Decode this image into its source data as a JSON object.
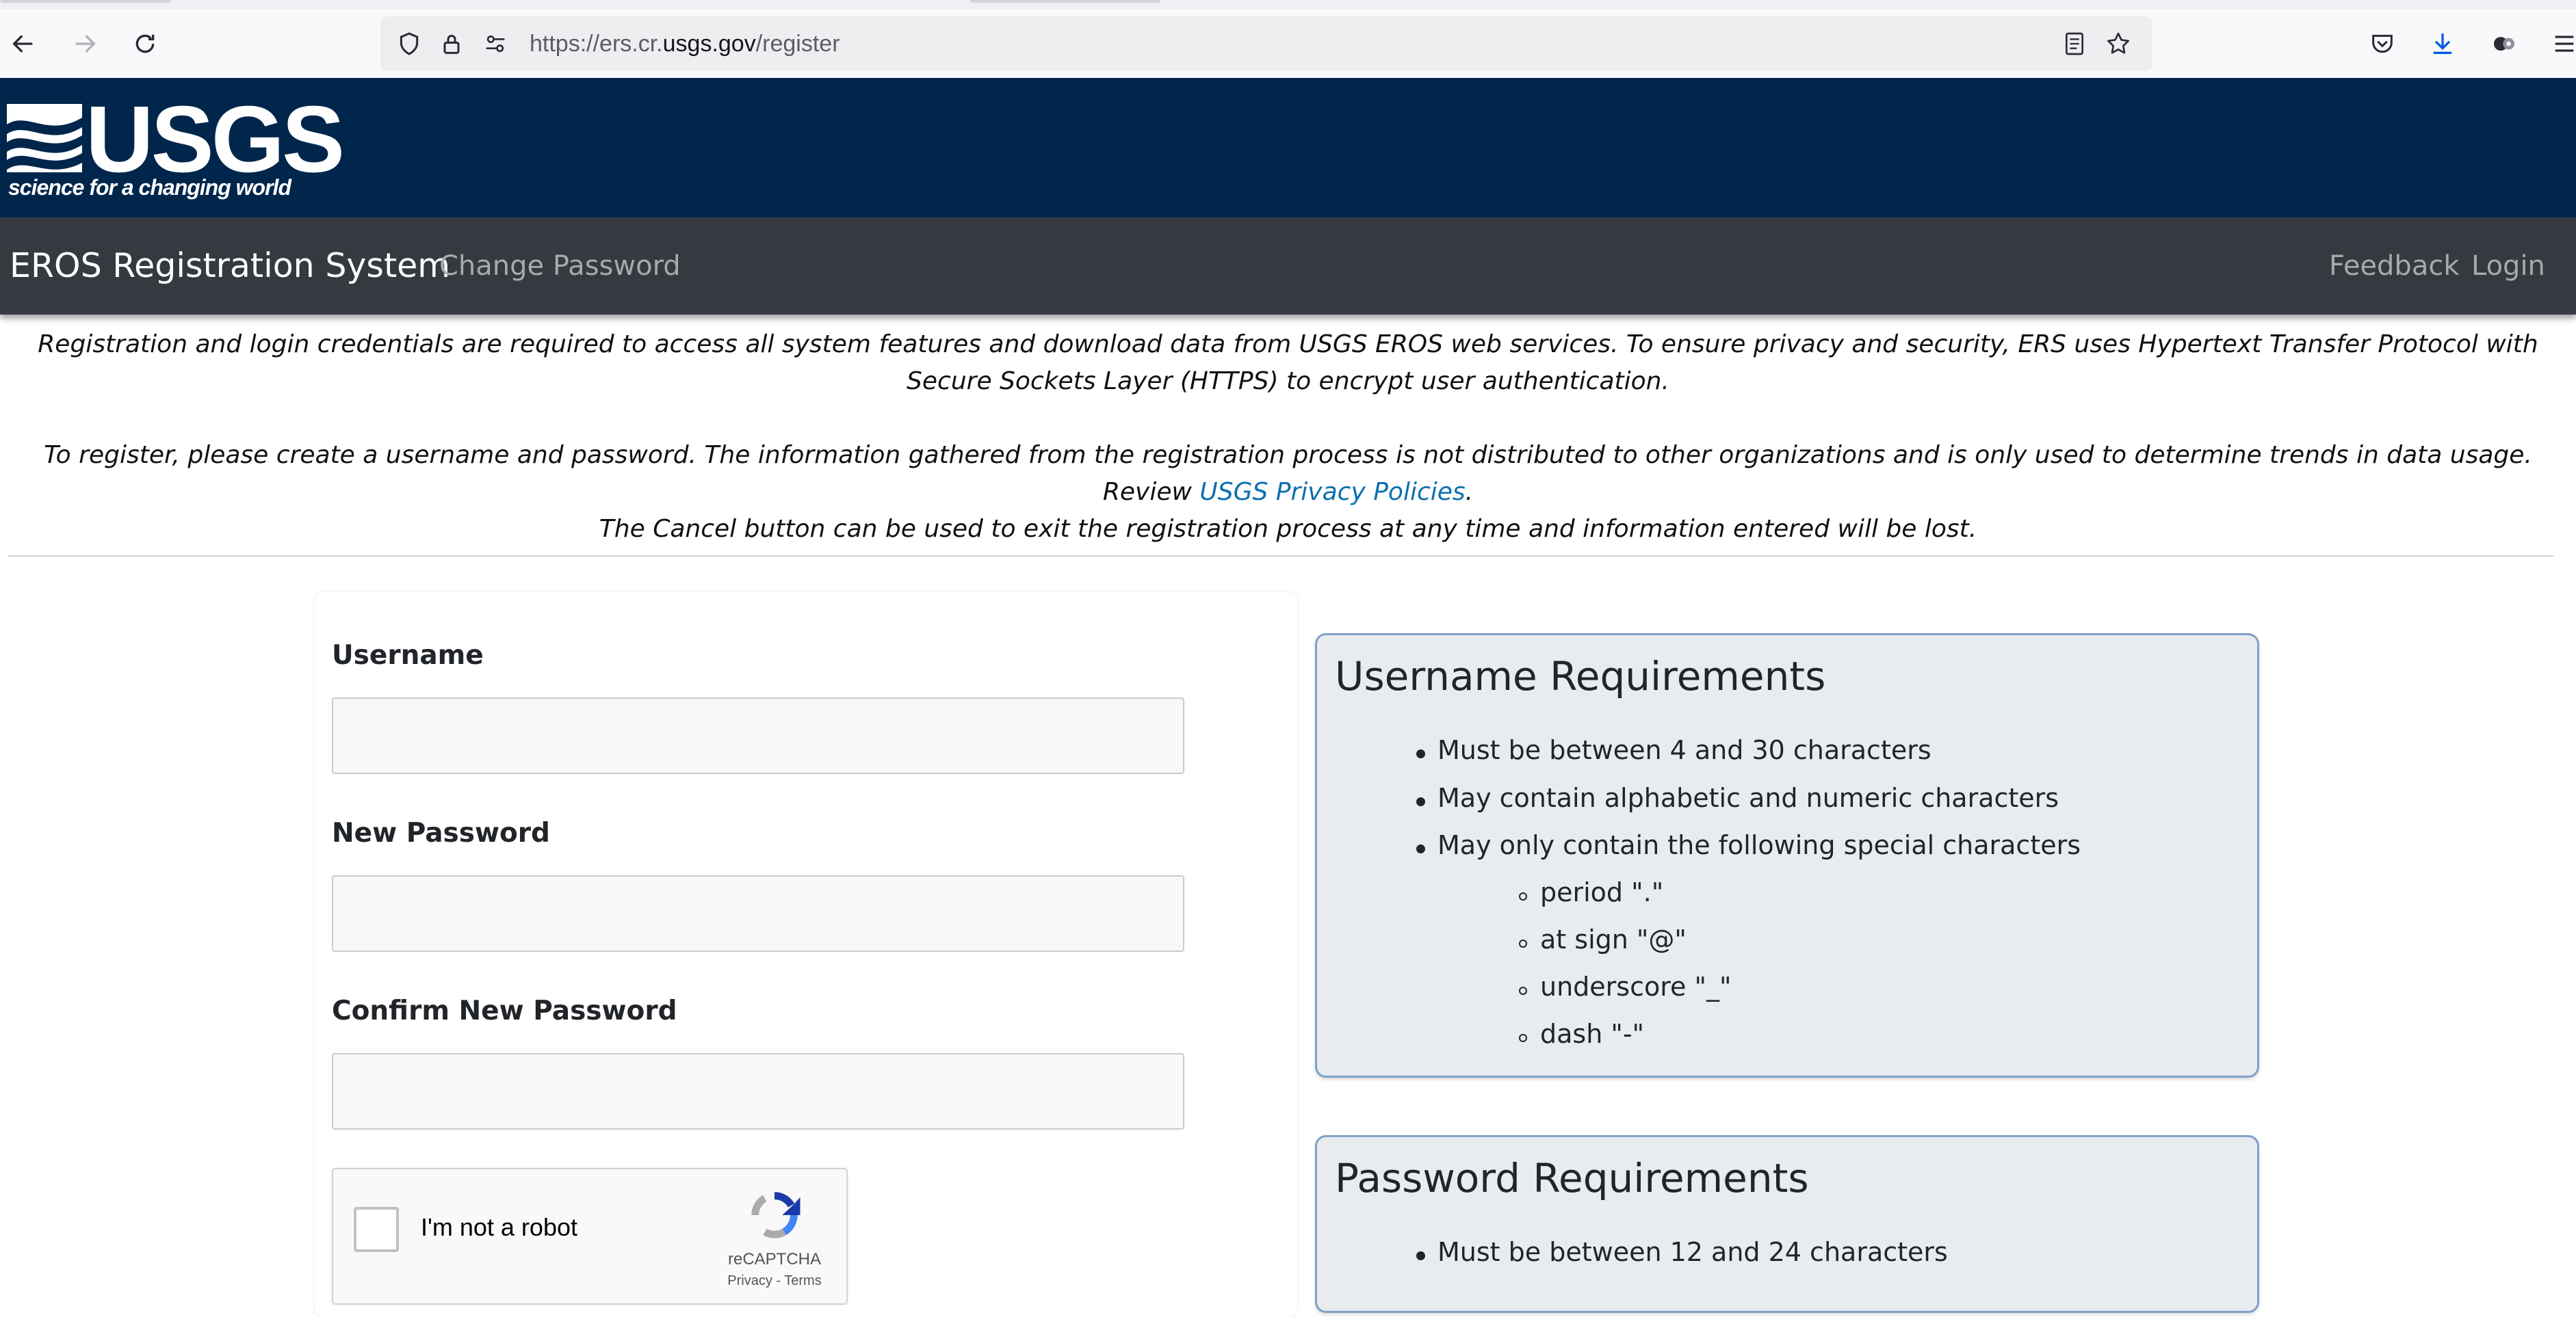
{
  "browser": {
    "url_prefix": "https://ers.cr.",
    "url_domain": "usgs.gov",
    "url_path": "/register"
  },
  "header": {
    "logo_wordmark": "USGS",
    "logo_tagline": "science for a changing world"
  },
  "navbar": {
    "brand": "EROS Registration System",
    "change_password": "Change Password",
    "feedback": "Feedback",
    "login": "Login"
  },
  "intro": {
    "p1": "Registration and login credentials are required to access all system features and download data from USGS EROS web services. To ensure privacy and security, ERS uses Hypertext Transfer Protocol with Secure Sockets Layer (HTTPS) to encrypt user authentication.",
    "p2_text": "To register, please create a username and password. The information gathered from the registration process is not distributed to other organizations and is only used to determine trends in data usage. Review ",
    "p2_link": "USGS Privacy Policies",
    "p2_end": ".",
    "p3": "The Cancel button can be used to exit the registration process at any time and information entered will be lost."
  },
  "form": {
    "username_label": "Username",
    "username_value": "",
    "new_password_label": "New Password",
    "new_password_value": "",
    "confirm_password_label": "Confirm New Password",
    "confirm_password_value": "",
    "captcha_label": "I'm not a robot",
    "captcha_brand": "reCAPTCHA",
    "captcha_links": "Privacy - Terms"
  },
  "username_requirements": {
    "title": "Username Requirements",
    "items": [
      "Must be between 4 and 30 characters",
      "May contain alphabetic and numeric characters",
      "May only contain the following special characters"
    ],
    "sub_items": [
      "period \".\"",
      "at sign \"@\"",
      "underscore \"_\"",
      "dash \"-\""
    ]
  },
  "password_requirements": {
    "title": "Password Requirements",
    "items": [
      "Must be between 12 and 24 characters"
    ]
  },
  "colors": {
    "usgs_banner": "#00264c",
    "navbar": "#343a40",
    "link": "#0c6fb0",
    "panel_bg": "#e9ecef",
    "panel_border": "#7fa1c9"
  }
}
